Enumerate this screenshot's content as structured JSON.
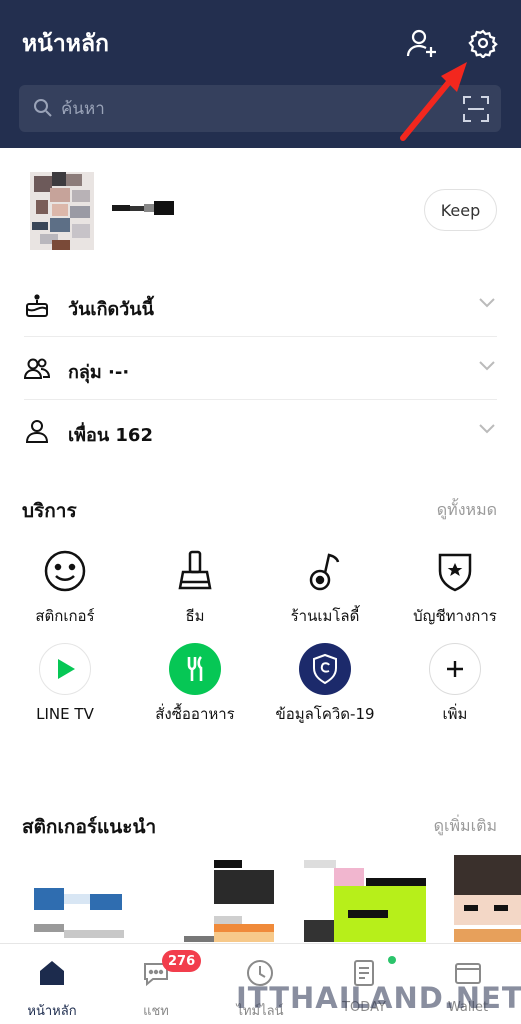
{
  "header": {
    "title": "หน้าหลัก",
    "search_placeholder": "ค้นหา"
  },
  "profile": {
    "keep_label": "Keep"
  },
  "rows": [
    {
      "label": "วันเกิดวันนี้",
      "icon": "cake-icon"
    },
    {
      "label": "กลุ่ม ·-·",
      "icon": "group-icon"
    },
    {
      "label": "เพื่อน 162",
      "icon": "friend-icon"
    }
  ],
  "services": {
    "title": "บริการ",
    "see_all": "ดูทั้งหมด",
    "items": [
      {
        "label": "สติกเกอร์",
        "icon": "smiley-icon"
      },
      {
        "label": "ธีม",
        "icon": "brush-icon"
      },
      {
        "label": "ร้านเมโลดี้",
        "icon": "music-note-icon"
      },
      {
        "label": "บัญชีทางการ",
        "icon": "shield-star-icon"
      },
      {
        "label": "LINE TV",
        "icon": "play-icon"
      },
      {
        "label": "สั่งซื้ออาหาร",
        "icon": "fork-icon"
      },
      {
        "label": "ข้อมูลโควิด-19",
        "icon": "covid-shield-icon"
      },
      {
        "label": "เพิ่ม",
        "icon": "plus-icon"
      }
    ]
  },
  "stickers": {
    "title": "สติกเกอร์แนะนำ",
    "see_more": "ดูเพิ่มเติม"
  },
  "bottom_nav": {
    "items": [
      {
        "label": "หน้าหลัก",
        "icon": "home-icon",
        "active": true
      },
      {
        "label": "แชท",
        "icon": "chat-icon",
        "badge": "276"
      },
      {
        "label": "ไทม์ไลน์",
        "icon": "clock-icon"
      },
      {
        "label": "TODAY",
        "icon": "news-icon"
      },
      {
        "label": "Wallet",
        "icon": "wallet-icon"
      }
    ]
  },
  "watermark": "ITTHAILAND.NET",
  "colors": {
    "header_bg": "#232f4f",
    "search_bg": "#35405d",
    "badge": "#f23d4c",
    "line_green": "#06c755"
  }
}
